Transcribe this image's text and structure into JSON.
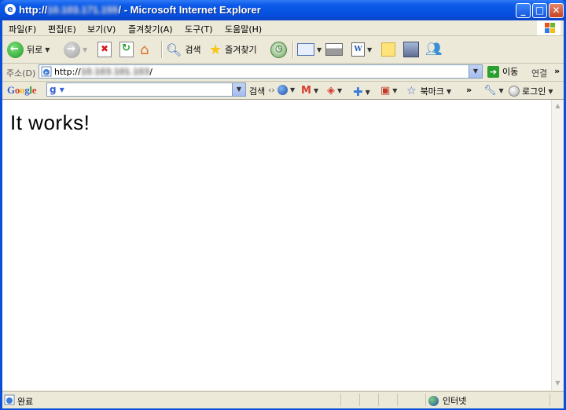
{
  "window": {
    "title_url_prefix": "http://",
    "title_url_host": "10.103.171.155",
    "title_url_suffix": "/",
    "title_app": " - Microsoft Internet Explorer"
  },
  "menu": [
    "파일(F)",
    "편집(E)",
    "보기(V)",
    "즐겨찾기(A)",
    "도구(T)",
    "도움말(H)"
  ],
  "toolbar": {
    "back_label": "뒤로",
    "search_label": "검색",
    "favorites_label": "즐겨찾기"
  },
  "address": {
    "label": "주소(D)",
    "url_prefix": "http://",
    "url_host": "10.103.101.103",
    "url_suffix": "/",
    "go_label": "이동",
    "links_label": "연결"
  },
  "google_toolbar": {
    "logo": "Google",
    "search_label": "검색",
    "bookmarks_label": "북마크",
    "login_label": "로그인"
  },
  "content": {
    "heading": "It works!"
  },
  "status": {
    "text": "완료",
    "zone": "인터넷"
  },
  "colors": {
    "titlebar": "#0650df",
    "chrome": "#ece9d8",
    "go_green": "#2a9f2f"
  }
}
